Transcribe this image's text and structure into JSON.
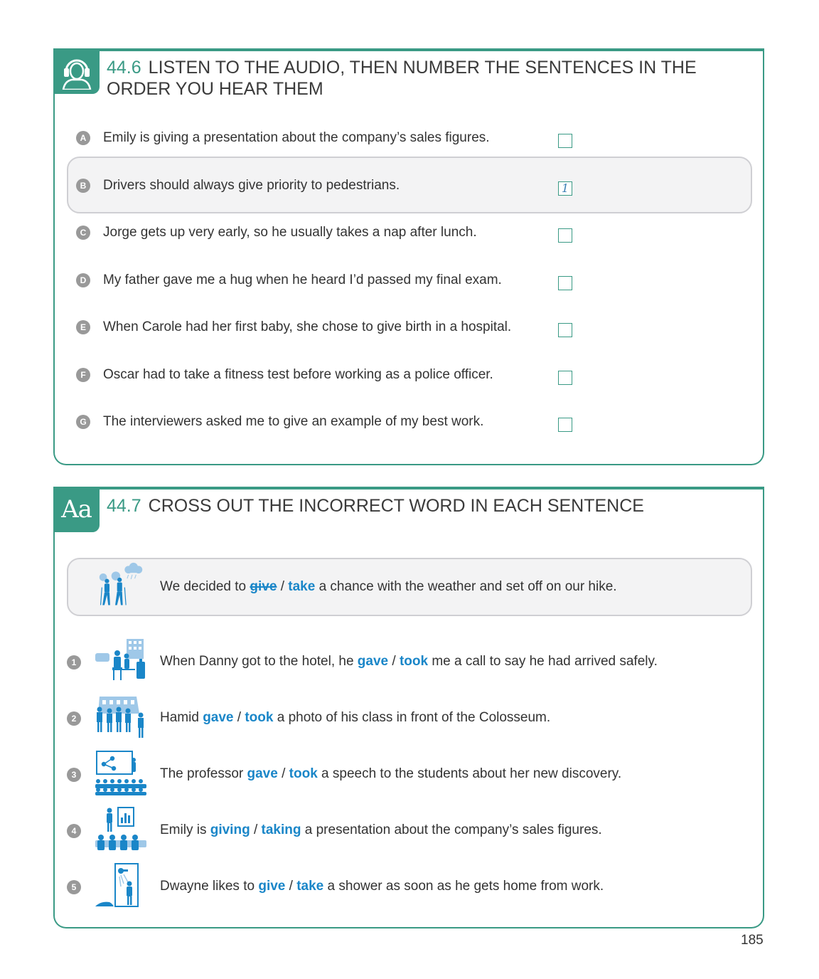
{
  "exercise_1": {
    "number": "44.6",
    "title_line1": "LISTEN TO THE AUDIO, THEN NUMBER THE SENTENCES IN THE",
    "title_line2": "ORDER YOU HEAR THEM",
    "icon": "headphones-person-icon",
    "items": [
      {
        "letter": "A",
        "text": "Emily is giving a presentation about the company’s sales figures.",
        "answer": ""
      },
      {
        "letter": "B",
        "text": "Drivers should always give priority to pedestrians.",
        "answer": "1"
      },
      {
        "letter": "C",
        "text": "Jorge gets up very early, so he usually takes a nap after lunch.",
        "answer": ""
      },
      {
        "letter": "D",
        "text": "My father gave me a hug when he heard I’d passed my final exam.",
        "answer": ""
      },
      {
        "letter": "E",
        "text": "When Carole had her first baby, she chose to give birth in a hospital.",
        "answer": ""
      },
      {
        "letter": "F",
        "text": "Oscar had to take a fitness test before working as a police officer.",
        "answer": ""
      },
      {
        "letter": "G",
        "text": "The interviewers asked me to give an example of my best work.",
        "answer": ""
      }
    ]
  },
  "exercise_2": {
    "number": "44.7",
    "title": "CROSS OUT THE INCORRECT WORD IN EACH SENTENCE",
    "badge": "Aa",
    "example": {
      "before": "We decided to ",
      "option1": "give",
      "slash": " / ",
      "option2": "take",
      "after": " a chance with the weather and set off on our hike.",
      "icon": "hikers-rain-icon"
    },
    "items": [
      {
        "num": "1",
        "before": "When Danny got to the hotel, he ",
        "option1": "gave",
        "slash": " / ",
        "option2": "took",
        "after": " me a call to say he had arrived safely.",
        "icon": "hotel-reception-icon"
      },
      {
        "num": "2",
        "before": "Hamid ",
        "option1": "gave",
        "slash": " / ",
        "option2": "took",
        "after": " a photo of his class in front of the Colosseum.",
        "icon": "class-photo-colosseum-icon"
      },
      {
        "num": "3",
        "before": "The professor ",
        "option1": "gave",
        "slash": " / ",
        "option2": "took",
        "after": " a speech to the students about her new discovery.",
        "icon": "lecture-audience-icon"
      },
      {
        "num": "4",
        "before": "Emily is ",
        "option1": "giving",
        "slash": " / ",
        "option2": "taking",
        "after": " a presentation about the company’s sales figures.",
        "icon": "presentation-chart-icon"
      },
      {
        "num": "5",
        "before": "Dwayne likes to ",
        "option1": "give",
        "slash": " / ",
        "option2": "take",
        "after": " a shower as soon as he gets home from work.",
        "icon": "shower-icon"
      }
    ]
  },
  "page_number": "185",
  "colors": {
    "accent": "#3a9a85",
    "option_blue": "#1a86c8",
    "highlight_bg": "#f3f3f4"
  }
}
